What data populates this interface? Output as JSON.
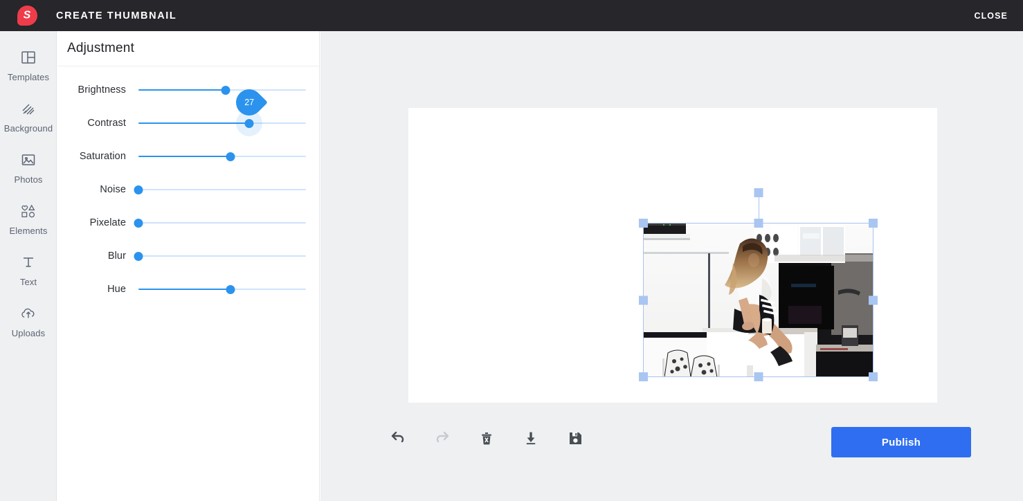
{
  "header": {
    "logo_letter": "S",
    "logo_color": "#ef3c4a",
    "title": "CREATE THUMBNAIL",
    "close_label": "CLOSE",
    "background_color": "#26262b"
  },
  "sidebar": {
    "items": [
      {
        "label": "Templates",
        "icon": "templates-icon"
      },
      {
        "label": "Background",
        "icon": "background-icon"
      },
      {
        "label": "Photos",
        "icon": "photos-icon"
      },
      {
        "label": "Elements",
        "icon": "elements-icon"
      },
      {
        "label": "Text",
        "icon": "text-icon"
      },
      {
        "label": "Uploads",
        "icon": "uploads-icon"
      }
    ]
  },
  "panel": {
    "title": "Adjustment",
    "accent_color": "#2b93ed",
    "track_color": "#cde4fb",
    "sliders": [
      {
        "label": "Brightness",
        "value": 52,
        "percent": 52,
        "active": false
      },
      {
        "label": "Contrast",
        "value": 27,
        "percent": 66,
        "active": true,
        "bubble": "27"
      },
      {
        "label": "Saturation",
        "value": 55,
        "percent": 55,
        "active": false
      },
      {
        "label": "Noise",
        "value": 0,
        "percent": 0,
        "active": false
      },
      {
        "label": "Pixelate",
        "value": 0,
        "percent": 0,
        "active": false
      },
      {
        "label": "Blur",
        "value": 0,
        "percent": 0,
        "active": false
      },
      {
        "label": "Hue",
        "value": 55,
        "percent": 55,
        "active": false
      }
    ]
  },
  "workspace": {
    "canvas_background": "#ffffff",
    "surface_background": "#eef0f2",
    "selection_color": "#a9c6f2",
    "selected_object": "photo-woman-sitting-on-kitchen-counter"
  },
  "toolbar": {
    "buttons": [
      {
        "name": "undo-button",
        "icon": "undo-icon",
        "enabled": true
      },
      {
        "name": "redo-button",
        "icon": "redo-icon",
        "enabled": false
      },
      {
        "name": "delete-button",
        "icon": "trash-x-icon",
        "enabled": true
      },
      {
        "name": "download-button",
        "icon": "download-icon",
        "enabled": true
      },
      {
        "name": "save-button",
        "icon": "floppy-icon",
        "enabled": true
      }
    ],
    "publish_label": "Publish",
    "publish_color": "#2f6ef0"
  }
}
